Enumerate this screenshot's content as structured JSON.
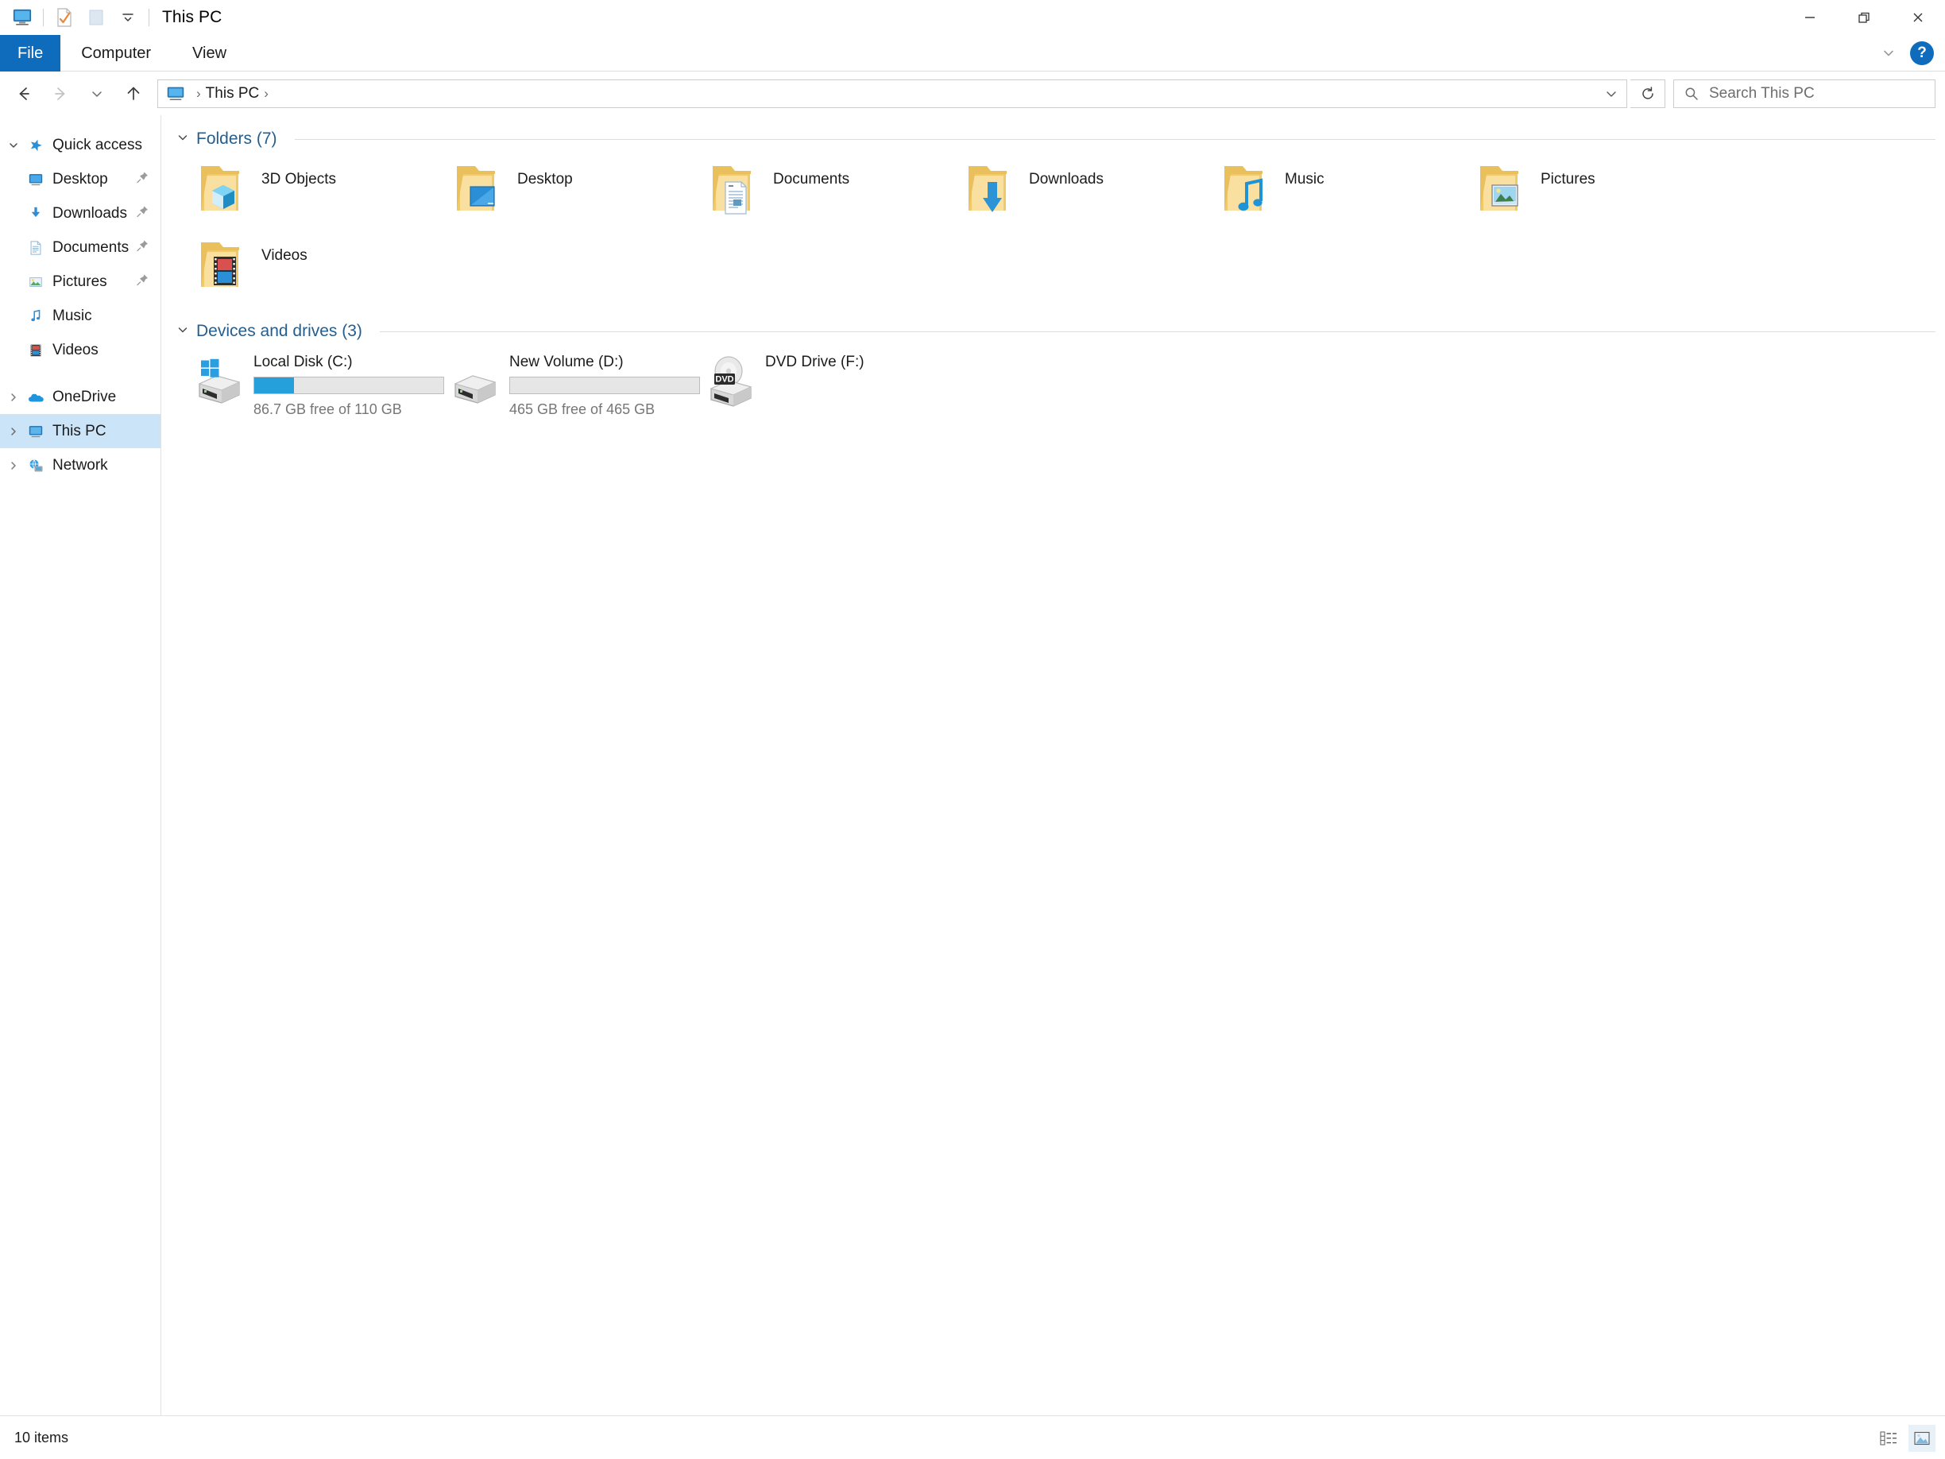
{
  "window": {
    "title": "This PC",
    "quick_access_toolbar": [
      {
        "name": "this-pc-icon",
        "label": "This PC"
      },
      {
        "name": "properties-icon",
        "label": "Properties"
      },
      {
        "name": "new-folder-icon",
        "label": "New folder"
      },
      {
        "name": "customize-dropdown-icon",
        "label": "Customize Quick Access Toolbar"
      }
    ],
    "controls": {
      "minimize": "Minimize",
      "restore": "Restore Down",
      "close": "Close"
    }
  },
  "ribbon": {
    "tabs": [
      {
        "label": "File",
        "active": true
      },
      {
        "label": "Computer",
        "active": false
      },
      {
        "label": "View",
        "active": false
      }
    ],
    "expand_label": "Expand the Ribbon",
    "help_label": "?"
  },
  "address": {
    "back_label": "Back",
    "forward_label": "Forward",
    "recent_label": "Recent locations",
    "up_label": "Up",
    "breadcrumb_root_icon": "this-pc-icon",
    "breadcrumb_sep_1": "›",
    "breadcrumb_item": "This PC",
    "breadcrumb_sep_2": "›",
    "dropdown_glyph": "⌄",
    "refresh_glyph": "↻"
  },
  "search": {
    "placeholder": "Search This PC",
    "icon": "search-icon"
  },
  "sidebar": {
    "items": [
      {
        "label": "Quick access",
        "icon": "star-icon",
        "chevron": "expanded",
        "indent": false,
        "pinned": false,
        "selected": false
      },
      {
        "label": "Desktop",
        "icon": "desktop-icon",
        "chevron": "none",
        "indent": true,
        "pinned": true,
        "selected": false
      },
      {
        "label": "Downloads",
        "icon": "downloads-icon",
        "chevron": "none",
        "indent": true,
        "pinned": true,
        "selected": false
      },
      {
        "label": "Documents",
        "icon": "documents-icon",
        "chevron": "none",
        "indent": true,
        "pinned": true,
        "selected": false
      },
      {
        "label": "Pictures",
        "icon": "pictures-icon",
        "chevron": "none",
        "indent": true,
        "pinned": true,
        "selected": false
      },
      {
        "label": "Music",
        "icon": "music-icon",
        "chevron": "none",
        "indent": true,
        "pinned": false,
        "selected": false
      },
      {
        "label": "Videos",
        "icon": "videos-icon",
        "chevron": "none",
        "indent": true,
        "pinned": false,
        "selected": false
      },
      {
        "label": "OneDrive",
        "icon": "onedrive-icon",
        "chevron": "collapsed",
        "indent": false,
        "pinned": false,
        "selected": false
      },
      {
        "label": "This PC",
        "icon": "this-pc-icon",
        "chevron": "collapsed",
        "indent": false,
        "pinned": false,
        "selected": true
      },
      {
        "label": "Network",
        "icon": "network-icon",
        "chevron": "collapsed",
        "indent": false,
        "pinned": false,
        "selected": false
      }
    ]
  },
  "main": {
    "groups": [
      {
        "title": "Folders (7)",
        "collapsed": false,
        "items": [
          {
            "label": "3D Objects",
            "icon": "folder-3d-objects-icon"
          },
          {
            "label": "Desktop",
            "icon": "folder-desktop-icon"
          },
          {
            "label": "Documents",
            "icon": "folder-documents-icon"
          },
          {
            "label": "Downloads",
            "icon": "folder-downloads-icon"
          },
          {
            "label": "Music",
            "icon": "folder-music-icon"
          },
          {
            "label": "Pictures",
            "icon": "folder-pictures-icon"
          },
          {
            "label": "Videos",
            "icon": "folder-videos-icon"
          }
        ]
      },
      {
        "title": "Devices and drives (3)",
        "collapsed": false,
        "drives": [
          {
            "label": "Local Disk (C:)",
            "icon": "windows-drive-icon",
            "has_bar": true,
            "used_percent": 21,
            "capacity_text": "86.7 GB free of 110 GB"
          },
          {
            "label": "New Volume (D:)",
            "icon": "hard-drive-icon",
            "has_bar": true,
            "used_percent": 0,
            "capacity_text": "465 GB free of 465 GB"
          },
          {
            "label": "DVD Drive (F:)",
            "icon": "dvd-drive-icon",
            "has_bar": false,
            "used_percent": 0,
            "capacity_text": ""
          }
        ]
      }
    ]
  },
  "statusbar": {
    "item_count": "10 items",
    "view_details_label": "Details view",
    "view_large_icons_label": "Large icons view"
  },
  "colors": {
    "accent": "#0f6cbd",
    "selection": "#cce4f7",
    "group_title": "#245e8f",
    "progress_fill": "#26a0da",
    "folder_yellow": "#f7d278"
  }
}
